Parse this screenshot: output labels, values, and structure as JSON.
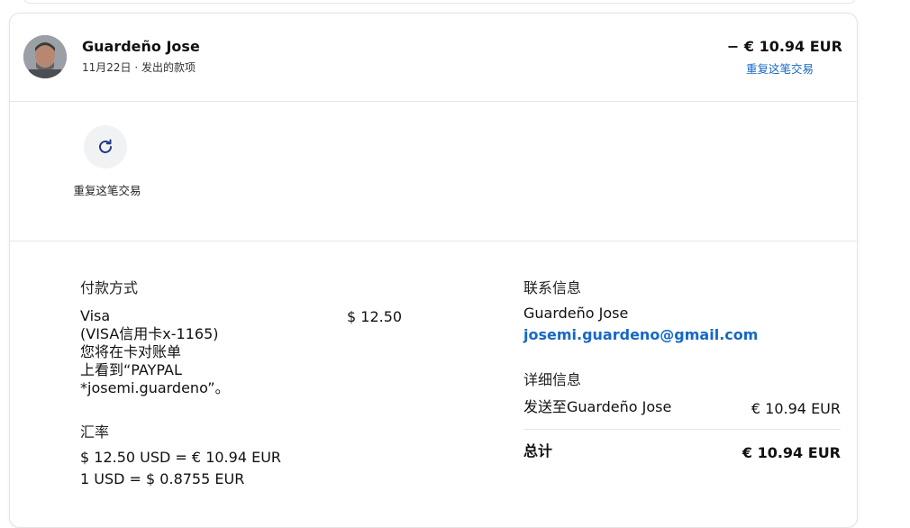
{
  "transaction": {
    "name": "Guardeño Jose",
    "date": "11月22日",
    "separator": "·",
    "type": "发出的款项",
    "amount": "− € 10.94 EUR",
    "repeat_link": "重复这笔交易"
  },
  "actions": {
    "repeat_label": "重复这笔交易",
    "repeat_icon": "refresh-icon"
  },
  "payment": {
    "title": "付款方式",
    "method_lines": [
      "Visa",
      "(VISA信用卡x-1165)",
      "您将在卡对账单",
      "上看到“PAYPAL",
      "*josemi.guardeno”。"
    ],
    "amount": "$ 12.50"
  },
  "exchange": {
    "title": "汇率",
    "line1": "$ 12.50 USD = € 10.94 EUR",
    "line2": "1 USD = $ 0.8755 EUR"
  },
  "contact": {
    "title": "联系信息",
    "name": "Guardeño Jose",
    "email": "josemi.guardeno@gmail.com"
  },
  "details": {
    "title": "详细信息",
    "sent_label": "发送至Guardeño Jose",
    "sent_amount": "€ 10.94 EUR",
    "total_label": "总计",
    "total_amount": "€ 10.94 EUR"
  },
  "colors": {
    "link": "#1668c6",
    "icon": "#1e3a8a"
  }
}
